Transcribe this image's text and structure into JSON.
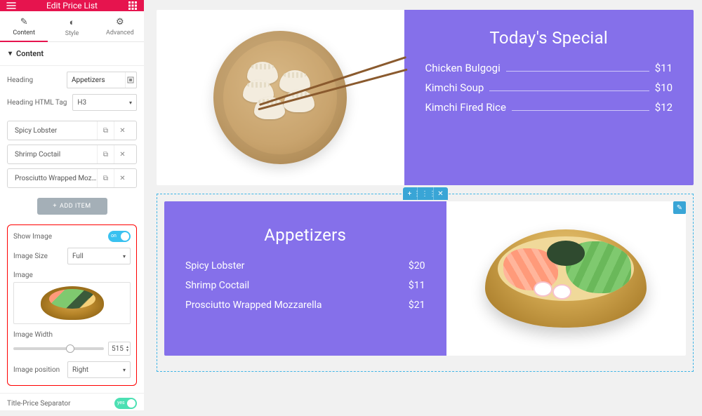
{
  "header": {
    "title": "Edit Price List"
  },
  "tabs": {
    "content": "Content",
    "style": "Style",
    "advanced": "Advanced"
  },
  "section": {
    "title": "Content"
  },
  "fields": {
    "heading_label": "Heading",
    "heading_value": "Appetizers",
    "html_tag_label": "Heading HTML Tag",
    "html_tag_value": "H3",
    "add_item": "ADD ITEM",
    "show_image_label": "Show Image",
    "image_size_label": "Image Size",
    "image_size_value": "Full",
    "image_label": "Image",
    "image_width_label": "Image Width",
    "image_width_value": "515",
    "image_position_label": "Image position",
    "image_position_value": "Right",
    "separator_label": "Title-Price Separator"
  },
  "list_items": [
    {
      "label": "Spicy Lobster"
    },
    {
      "label": "Shrimp Coctail"
    },
    {
      "label": "Prosciutto Wrapped Mozza..."
    }
  ],
  "preview": {
    "top": {
      "title": "Today's Special",
      "items": [
        {
          "name": "Chicken Bulgogi",
          "price": "$11"
        },
        {
          "name": "Kimchi Soup",
          "price": "$10"
        },
        {
          "name": "Kimchi Fired Rice",
          "price": "$12"
        }
      ]
    },
    "bottom": {
      "title": "Appetizers",
      "items": [
        {
          "name": "Spicy Lobster",
          "price": "$20"
        },
        {
          "name": "Shrimp Coctail",
          "price": "$11"
        },
        {
          "name": "Prosciutto Wrapped Mozzarella",
          "price": "$21"
        }
      ]
    }
  }
}
